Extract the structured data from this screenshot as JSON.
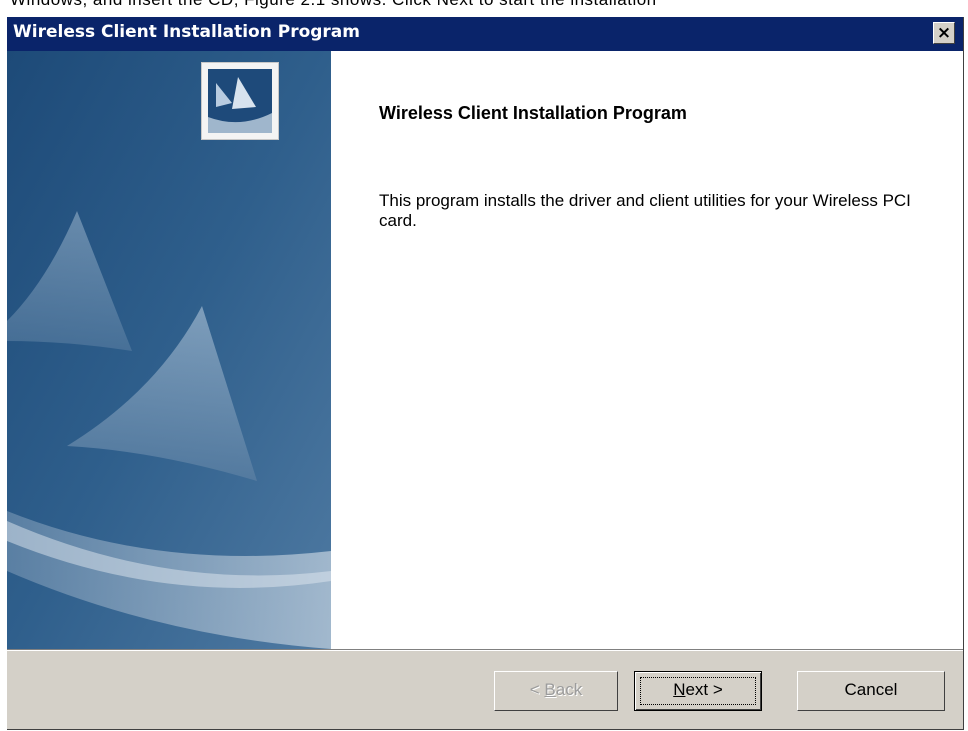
{
  "top_strip_text": "Windows, and insert the CD; Figure 2.1 shows. Click Next to start the installation",
  "window": {
    "title": "Wireless Client Installation Program",
    "close_label": "×"
  },
  "main": {
    "heading": "Wireless Client Installation Program",
    "description": "This program installs the driver and client utilities for your Wireless PCI card."
  },
  "buttons": {
    "back": {
      "mnemonic": "B",
      "rest": "ack",
      "prefix": "< ",
      "enabled": false
    },
    "next": {
      "mnemonic": "N",
      "rest": "ext >",
      "focused": true
    },
    "cancel": "Cancel"
  },
  "icons": {
    "side_banner": "sail-arch-graphic",
    "logo": "setup-logo-icon",
    "close": "close-icon"
  },
  "colors": {
    "title_bar": "#0a246a",
    "dialog_face": "#d4d0c8",
    "banner_dark": "#17406b",
    "banner_light": "#7d9cb8"
  }
}
